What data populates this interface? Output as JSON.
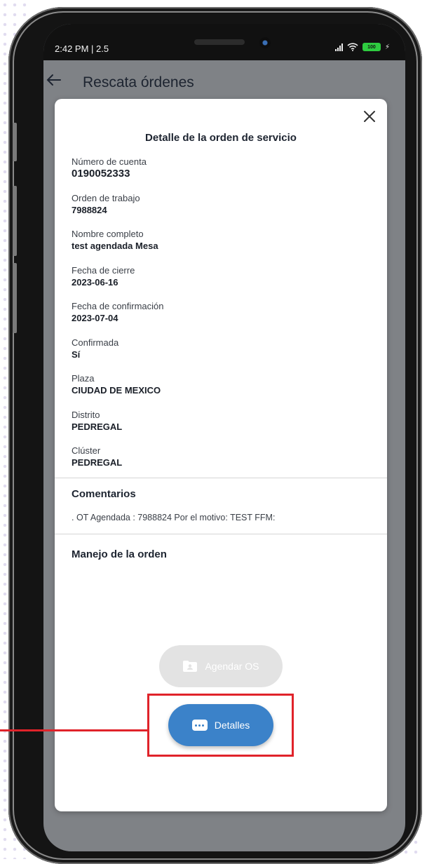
{
  "status_bar": {
    "time": "2:42 PM | 2.5",
    "battery": "100"
  },
  "app_bar": {
    "title": "Rescata órdenes",
    "back_icon": "arrow-left-icon"
  },
  "modal": {
    "title": "Detalle de la orden de servicio",
    "close_icon": "close-icon",
    "fields": [
      {
        "label": "Número de cuenta",
        "value": "0190052333"
      },
      {
        "label": "Orden de trabajo",
        "value": "7988824"
      },
      {
        "label": "Nombre completo",
        "value": "test agendada Mesa"
      },
      {
        "label": "Fecha de cierre",
        "value": "2023-06-16"
      },
      {
        "label": "Fecha de confirmación",
        "value": "2023-07-04"
      },
      {
        "label": "Confirmada",
        "value": "Sí"
      },
      {
        "label": "Plaza",
        "value": "CIUDAD DE MEXICO"
      },
      {
        "label": "Distrito",
        "value": "PEDREGAL"
      },
      {
        "label": "Clúster",
        "value": "PEDREGAL"
      }
    ],
    "comments_title": "Comentarios",
    "comments_text": ". OT Agendada : 7988824 Por el motivo: TEST FFM:",
    "handling_title": "Manejo de la orden",
    "schedule_button": {
      "label": "Agendar OS",
      "icon": "folder-user-icon",
      "disabled": true
    },
    "details_button": {
      "label": "Detalles",
      "icon": "more-chat-icon"
    }
  },
  "colors": {
    "primary": "#3b82c9",
    "highlight": "#e0232a",
    "disabled": "#e3e3e3",
    "overlay": "#7f8286"
  }
}
